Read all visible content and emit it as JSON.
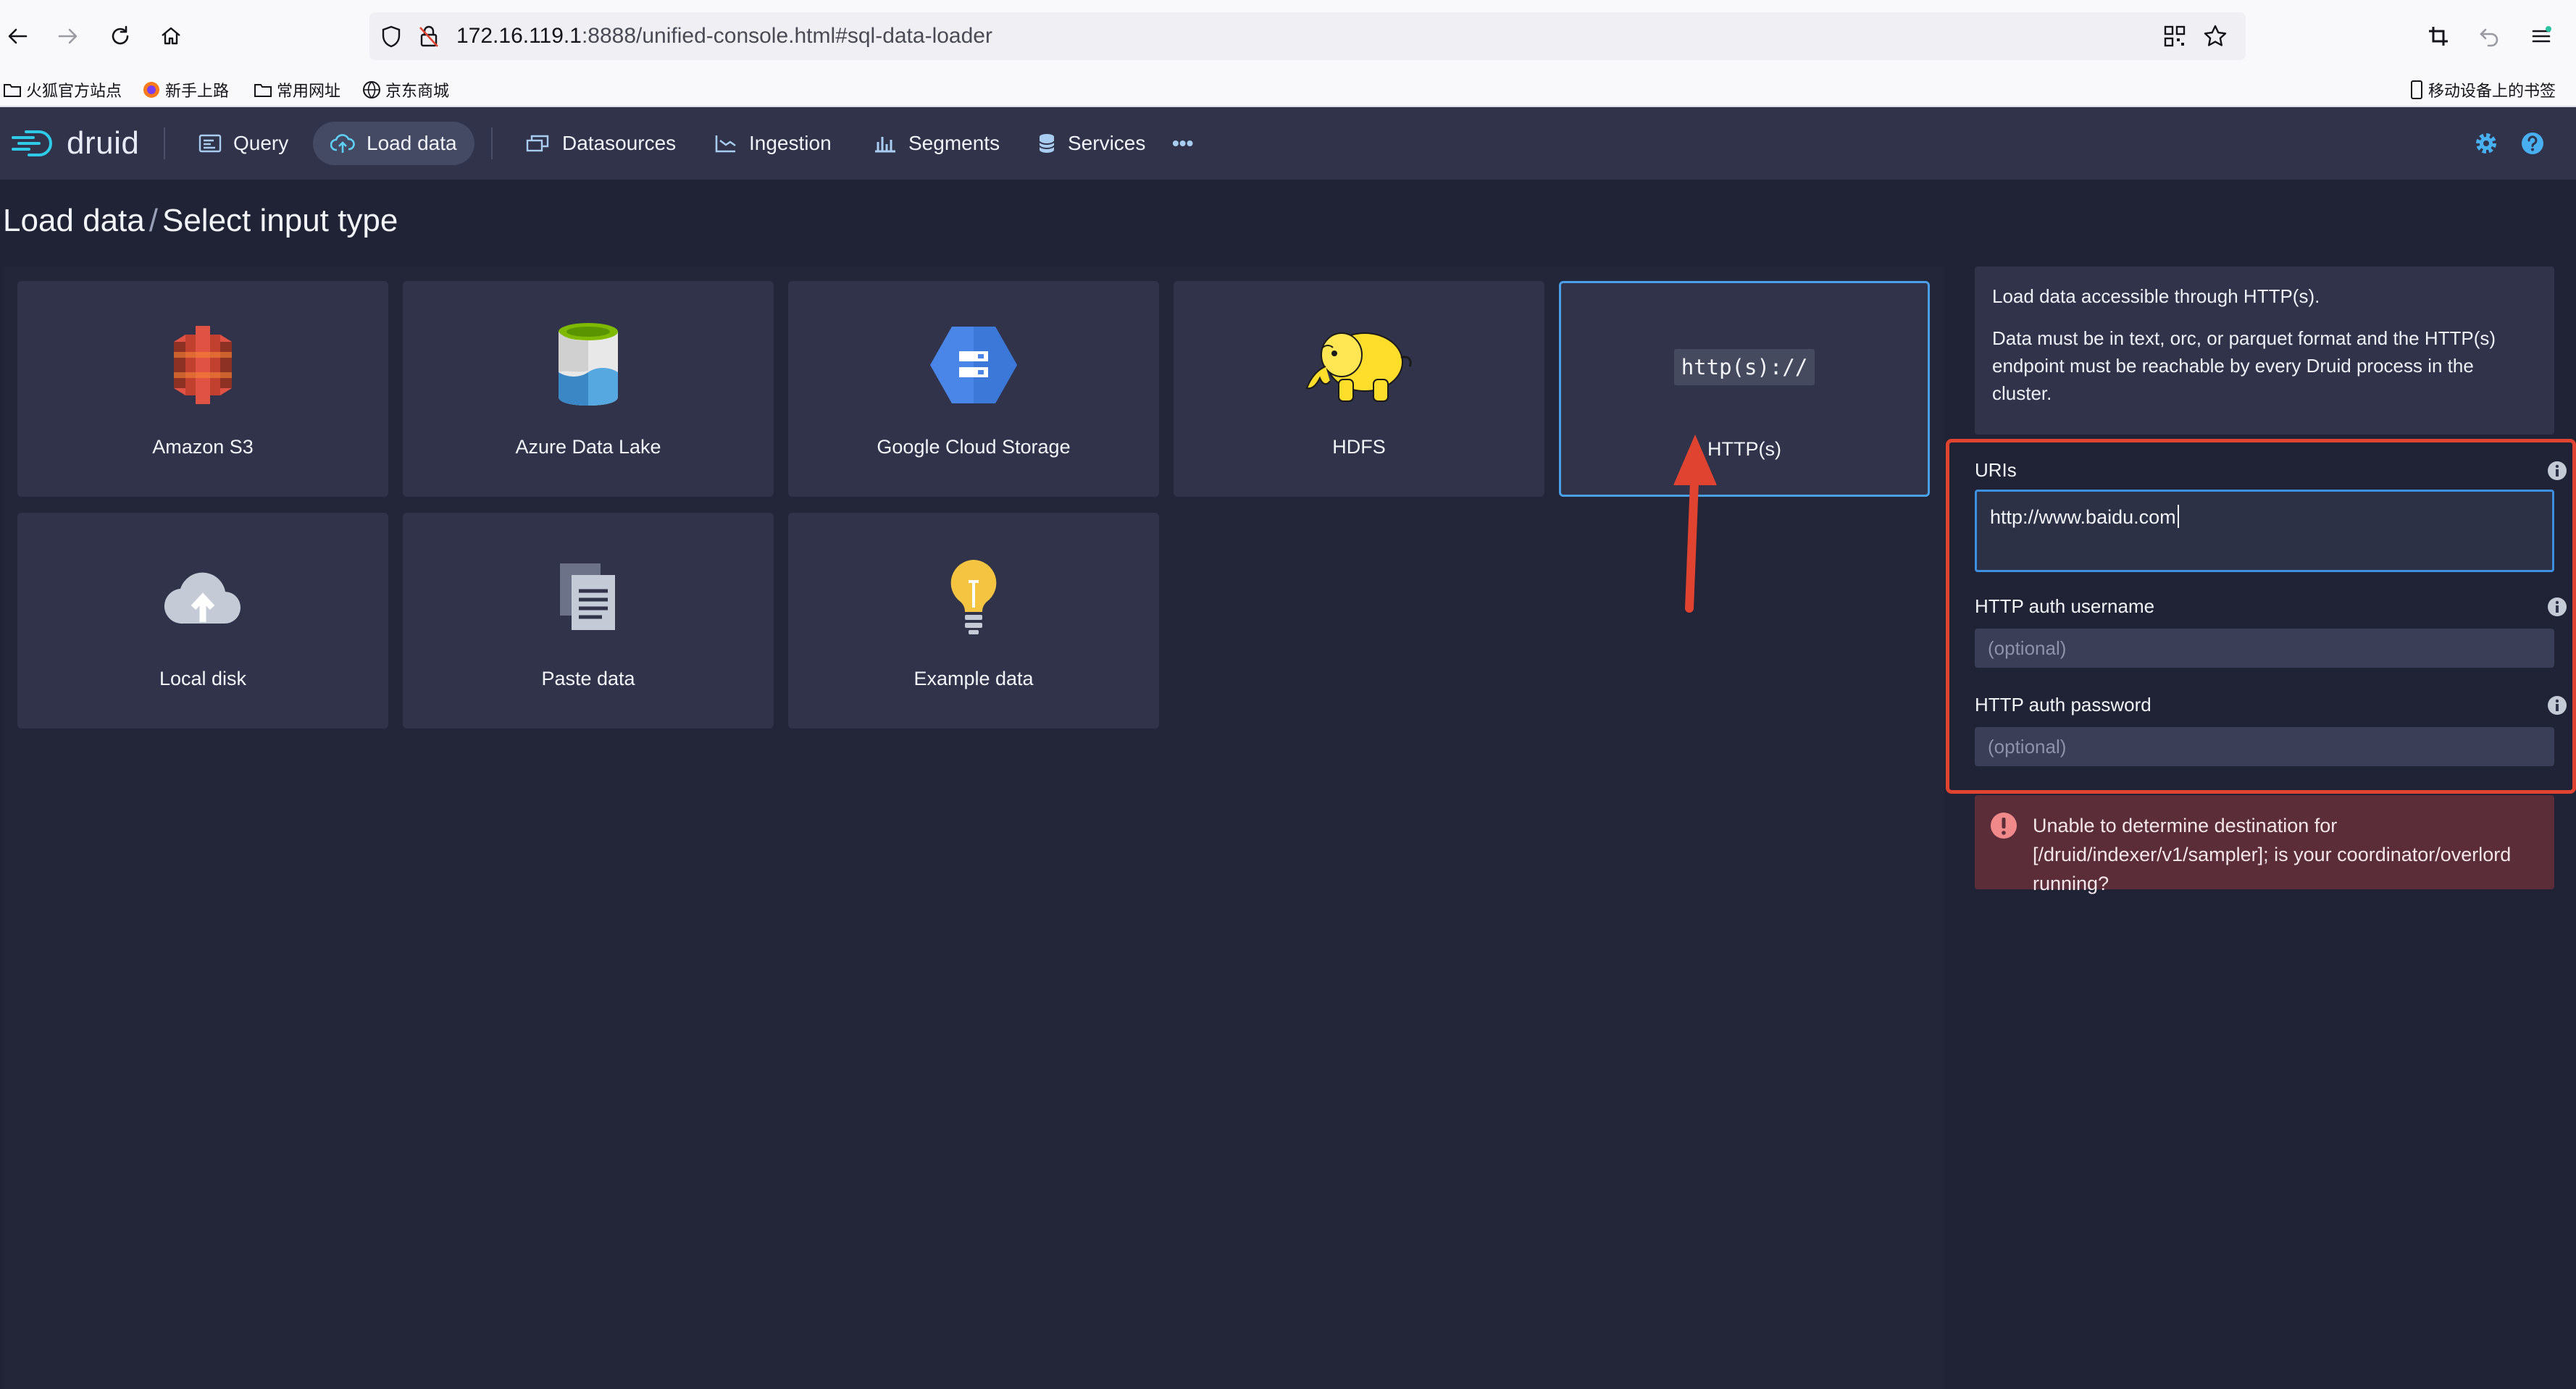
{
  "browser": {
    "url_host": "172.16.119.1",
    "url_rest": ":8888/unified-console.html#sql-data-loader",
    "bookmarks": [
      "火狐官方站点",
      "新手上路",
      "常用网址",
      "京东商城"
    ],
    "mobile_bookmarks": "移动设备上的书签"
  },
  "app": {
    "logo": "druid",
    "nav": {
      "query": "Query",
      "load_data": "Load data",
      "datasources": "Datasources",
      "ingestion": "Ingestion",
      "segments": "Segments",
      "services": "Services",
      "more": "•••"
    },
    "accent": "#48aff0"
  },
  "page": {
    "breadcrumb_root": "Load data",
    "breadcrumb_sep": "/",
    "breadcrumb_current": "Select input type"
  },
  "tiles": [
    {
      "label": "Amazon S3",
      "icon": "amazon-s3-icon"
    },
    {
      "label": "Azure Data Lake",
      "icon": "azure-data-lake-icon"
    },
    {
      "label": "Google Cloud Storage",
      "icon": "google-cloud-storage-icon"
    },
    {
      "label": "HDFS",
      "icon": "hadoop-elephant-icon"
    },
    {
      "label": "HTTP(s)",
      "icon_text": "http(s)://",
      "selected": true
    },
    {
      "label": "Local disk",
      "icon": "cloud-upload-icon"
    },
    {
      "label": "Paste data",
      "icon": "document-icon"
    },
    {
      "label": "Example data",
      "icon": "lightbulb-icon"
    }
  ],
  "panel": {
    "info_1": "Load data accessible through HTTP(s).",
    "info_2": "Data must be in text, orc, or parquet format and the HTTP(s) endpoint must be reachable by every Druid process in the cluster.",
    "uris_label": "URIs",
    "uris_value": "http://www.baidu.com",
    "username_label": "HTTP auth username",
    "username_placeholder": "(optional)",
    "password_label": "HTTP auth password",
    "password_placeholder": "(optional)",
    "error": "Unable to determine destination for [/druid/indexer/v1/sampler]; is your coordinator/overlord running?"
  }
}
